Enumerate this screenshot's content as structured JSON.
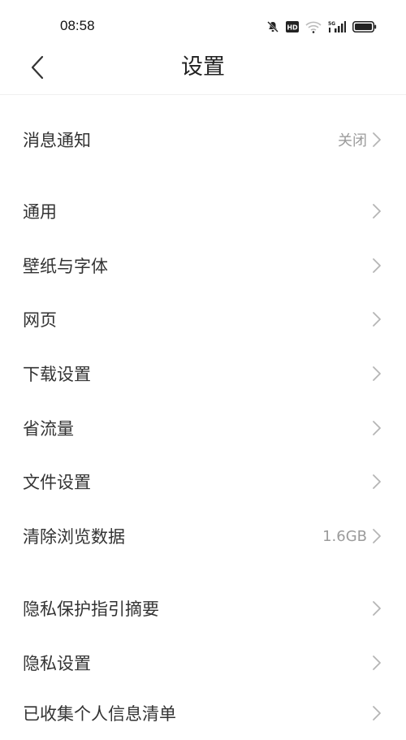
{
  "status": {
    "time": "08:58"
  },
  "header": {
    "title": "设置"
  },
  "rows": [
    {
      "label": "消息通知",
      "value": "关闭"
    },
    {
      "label": "通用",
      "value": ""
    },
    {
      "label": "壁纸与字体",
      "value": ""
    },
    {
      "label": "网页",
      "value": ""
    },
    {
      "label": "下载设置",
      "value": ""
    },
    {
      "label": "省流量",
      "value": ""
    },
    {
      "label": "文件设置",
      "value": ""
    },
    {
      "label": "清除浏览数据",
      "value": "1.6GB"
    },
    {
      "label": "隐私保护指引摘要",
      "value": ""
    },
    {
      "label": "隐私设置",
      "value": ""
    },
    {
      "label": "已收集个人信息清单",
      "value": ""
    }
  ]
}
